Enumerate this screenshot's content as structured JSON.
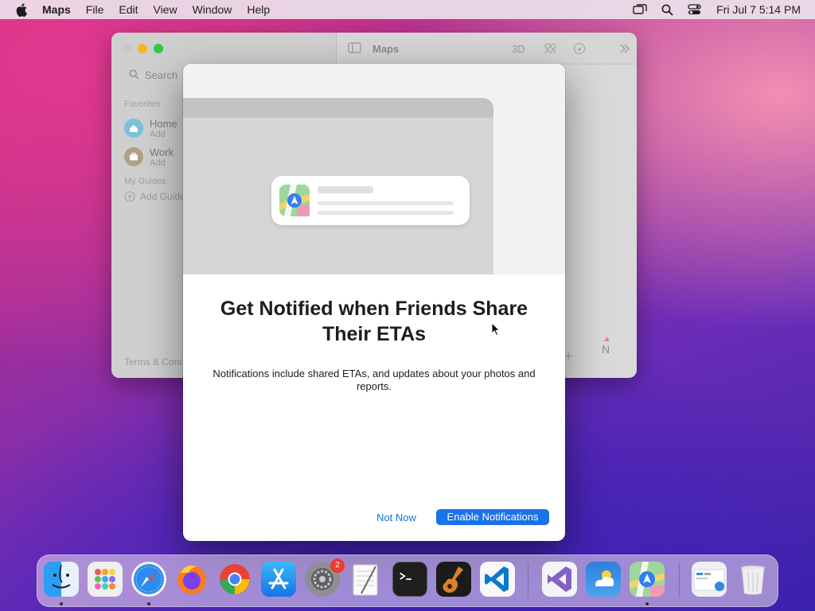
{
  "menubar": {
    "app_name": "Maps",
    "items": [
      "File",
      "Edit",
      "View",
      "Window",
      "Help"
    ],
    "clock": "Fri Jul 7  5:14 PM",
    "status_icons": [
      "screen-mirroring-icon",
      "search-icon",
      "control-center-icon"
    ]
  },
  "maps_window": {
    "title": "Maps",
    "toolbar_3d": "3D",
    "search_placeholder": "Search",
    "favorites_heading": "Favorites",
    "favorites": [
      {
        "title": "Home",
        "subtitle": "Add"
      },
      {
        "title": "Work",
        "subtitle": "Add"
      }
    ],
    "guides_heading": "My Guides",
    "add_guide": "Add Guide",
    "footer": "Terms & Conditions",
    "zoom_plus": "+",
    "compass": "N"
  },
  "dialog": {
    "title": "Get Notified when Friends Share Their ETAs",
    "body": "Notifications include shared ETAs, and updates about your photos and reports.",
    "secondary_button": "Not Now",
    "primary_button": "Enable Notifications"
  },
  "dock": {
    "apps": [
      "Finder",
      "Launchpad",
      "Safari",
      "Firefox",
      "Chrome",
      "App Store",
      "System Preferences",
      "TextEdit",
      "Terminal",
      "GarageBand",
      "Visual Studio Code",
      "Visual Studio",
      "Weather",
      "Maps",
      "Downloads",
      "Trash"
    ],
    "badge_count": "2"
  },
  "colors": {
    "accent": "#1a73e8",
    "link": "#1a6fd8",
    "badge": "#ee3b30"
  }
}
